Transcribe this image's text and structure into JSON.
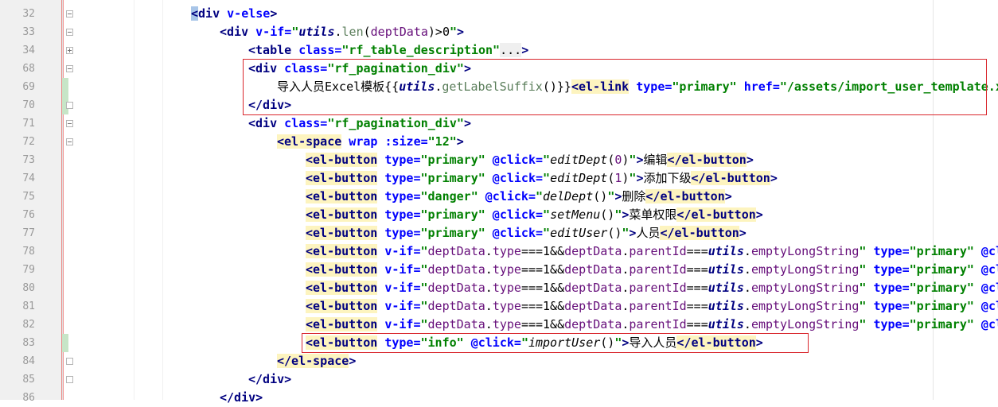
{
  "editor": {
    "lines": [
      {
        "num": "32",
        "indent": 0,
        "fold": "minus",
        "tokens": [
          {
            "t": "<",
            "c": "k-tag k-cur"
          },
          {
            "t": "div",
            "c": "k-tag"
          },
          {
            "t": " v-else",
            "c": "k-attr"
          },
          {
            "t": ">",
            "c": "k-tag"
          }
        ]
      },
      {
        "num": "33",
        "indent": 1,
        "fold": "minus",
        "tokens": [
          {
            "t": "<div",
            "c": "k-tag"
          },
          {
            "t": " v-if=",
            "c": "k-attr"
          },
          {
            "t": "\"",
            "c": "k-str"
          },
          {
            "t": "utils",
            "c": "k-kw"
          },
          {
            "t": ".",
            "c": "k-plain"
          },
          {
            "t": "len",
            "c": "k-fn"
          },
          {
            "t": "(",
            "c": "k-plain"
          },
          {
            "t": "deptData",
            "c": "k-var"
          },
          {
            "t": ")>0",
            "c": "k-plain"
          },
          {
            "t": "\"",
            "c": "k-str"
          },
          {
            "t": ">",
            "c": "k-tag"
          }
        ]
      },
      {
        "num": "34",
        "indent": 2,
        "fold": "plus",
        "tokens": [
          {
            "t": "<table",
            "c": "k-tag"
          },
          {
            "t": " class=",
            "c": "k-attr"
          },
          {
            "t": "\"rf_table_description\"",
            "c": "k-str"
          },
          {
            "t": "...",
            "c": "k-plain k-tagbg"
          },
          {
            "t": ">",
            "c": "k-tag"
          }
        ]
      },
      {
        "num": "68",
        "indent": 2,
        "fold": "minus",
        "tokens": [
          {
            "t": "<div",
            "c": "k-tag"
          },
          {
            "t": " class=",
            "c": "k-attr"
          },
          {
            "t": "\"rf_pagination_div\"",
            "c": "k-str"
          },
          {
            "t": ">",
            "c": "k-tag"
          }
        ]
      },
      {
        "num": "69",
        "indent": 3,
        "fold": "",
        "tokens": [
          {
            "t": "导入人员Excel模板{{",
            "c": "k-plain"
          },
          {
            "t": "utils",
            "c": "k-kw"
          },
          {
            "t": ".",
            "c": "k-plain"
          },
          {
            "t": "getLabelSuffix",
            "c": "k-fn"
          },
          {
            "t": "()}}",
            "c": "k-plain"
          },
          {
            "t": "<el-link",
            "c": "k-tag k-hl"
          },
          {
            "t": " type=",
            "c": "k-attr"
          },
          {
            "t": "\"primary\"",
            "c": "k-str"
          },
          {
            "t": " href=",
            "c": "k-attr"
          },
          {
            "t": "\"/assets/import_user_template.x",
            "c": "k-str"
          }
        ]
      },
      {
        "num": "70",
        "indent": 2,
        "fold": "end",
        "tokens": [
          {
            "t": "</div>",
            "c": "k-tag"
          }
        ]
      },
      {
        "num": "71",
        "indent": 2,
        "fold": "minus",
        "tokens": [
          {
            "t": "<div",
            "c": "k-tag"
          },
          {
            "t": " class=",
            "c": "k-attr"
          },
          {
            "t": "\"rf_pagination_div\"",
            "c": "k-str"
          },
          {
            "t": ">",
            "c": "k-tag"
          }
        ]
      },
      {
        "num": "72",
        "indent": 3,
        "fold": "minus",
        "tokens": [
          {
            "t": "<el-space",
            "c": "k-tag k-hl"
          },
          {
            "t": " wrap",
            "c": "k-attr"
          },
          {
            "t": " :size=",
            "c": "k-attr"
          },
          {
            "t": "\"12\"",
            "c": "k-str"
          },
          {
            "t": ">",
            "c": "k-tag"
          }
        ]
      },
      {
        "num": "73",
        "indent": 4,
        "fold": "",
        "tokens": [
          {
            "t": "<el-button",
            "c": "k-tag k-hl"
          },
          {
            "t": " type=",
            "c": "k-attr"
          },
          {
            "t": "\"primary\"",
            "c": "k-str"
          },
          {
            "t": " @click=",
            "c": "k-attr"
          },
          {
            "t": "\"",
            "c": "k-str"
          },
          {
            "t": "editDept",
            "c": "k-ital k-plain"
          },
          {
            "t": "(",
            "c": "k-plain"
          },
          {
            "t": "0",
            "c": "k-var"
          },
          {
            "t": ")",
            "c": "k-plain"
          },
          {
            "t": "\"",
            "c": "k-str"
          },
          {
            "t": ">",
            "c": "k-tag"
          },
          {
            "t": "编辑",
            "c": "k-plain"
          },
          {
            "t": "</el-button",
            "c": "k-tag k-hl"
          },
          {
            "t": ">",
            "c": "k-tag"
          }
        ]
      },
      {
        "num": "74",
        "indent": 4,
        "fold": "",
        "tokens": [
          {
            "t": "<el-button",
            "c": "k-tag k-hl"
          },
          {
            "t": " type=",
            "c": "k-attr"
          },
          {
            "t": "\"primary\"",
            "c": "k-str"
          },
          {
            "t": " @click=",
            "c": "k-attr"
          },
          {
            "t": "\"",
            "c": "k-str"
          },
          {
            "t": "editDept",
            "c": "k-ital k-plain"
          },
          {
            "t": "(",
            "c": "k-plain"
          },
          {
            "t": "1",
            "c": "k-var"
          },
          {
            "t": ")",
            "c": "k-plain"
          },
          {
            "t": "\"",
            "c": "k-str"
          },
          {
            "t": ">",
            "c": "k-tag"
          },
          {
            "t": "添加下级",
            "c": "k-plain"
          },
          {
            "t": "</el-button",
            "c": "k-tag k-hl"
          },
          {
            "t": ">",
            "c": "k-tag"
          }
        ]
      },
      {
        "num": "75",
        "indent": 4,
        "fold": "",
        "tokens": [
          {
            "t": "<el-button",
            "c": "k-tag k-hl"
          },
          {
            "t": " type=",
            "c": "k-attr"
          },
          {
            "t": "\"danger\"",
            "c": "k-str"
          },
          {
            "t": " @click=",
            "c": "k-attr"
          },
          {
            "t": "\"",
            "c": "k-str"
          },
          {
            "t": "delDept",
            "c": "k-ital k-plain"
          },
          {
            "t": "()",
            "c": "k-plain"
          },
          {
            "t": "\"",
            "c": "k-str"
          },
          {
            "t": ">",
            "c": "k-tag"
          },
          {
            "t": "删除",
            "c": "k-plain"
          },
          {
            "t": "</el-button",
            "c": "k-tag k-hl"
          },
          {
            "t": ">",
            "c": "k-tag"
          }
        ]
      },
      {
        "num": "76",
        "indent": 4,
        "fold": "",
        "tokens": [
          {
            "t": "<el-button",
            "c": "k-tag k-hl"
          },
          {
            "t": " type=",
            "c": "k-attr"
          },
          {
            "t": "\"primary\"",
            "c": "k-str"
          },
          {
            "t": " @click=",
            "c": "k-attr"
          },
          {
            "t": "\"",
            "c": "k-str"
          },
          {
            "t": "setMenu",
            "c": "k-ital k-plain"
          },
          {
            "t": "()",
            "c": "k-plain"
          },
          {
            "t": "\"",
            "c": "k-str"
          },
          {
            "t": ">",
            "c": "k-tag"
          },
          {
            "t": "菜单权限",
            "c": "k-plain"
          },
          {
            "t": "</el-button",
            "c": "k-tag k-hl"
          },
          {
            "t": ">",
            "c": "k-tag"
          }
        ]
      },
      {
        "num": "77",
        "indent": 4,
        "fold": "",
        "tokens": [
          {
            "t": "<el-button",
            "c": "k-tag k-hl"
          },
          {
            "t": " type=",
            "c": "k-attr"
          },
          {
            "t": "\"primary\"",
            "c": "k-str"
          },
          {
            "t": " @click=",
            "c": "k-attr"
          },
          {
            "t": "\"",
            "c": "k-str"
          },
          {
            "t": "editUser",
            "c": "k-ital k-plain"
          },
          {
            "t": "()",
            "c": "k-plain"
          },
          {
            "t": "\"",
            "c": "k-str"
          },
          {
            "t": ">",
            "c": "k-tag"
          },
          {
            "t": "人员",
            "c": "k-plain"
          },
          {
            "t": "</el-button",
            "c": "k-tag k-hl"
          },
          {
            "t": ">",
            "c": "k-tag"
          }
        ]
      },
      {
        "num": "78",
        "indent": 4,
        "fold": "",
        "tokens": [
          {
            "t": "<el-button",
            "c": "k-tag k-hl"
          },
          {
            "t": " v-if=",
            "c": "k-attr"
          },
          {
            "t": "\"",
            "c": "k-str"
          },
          {
            "t": "deptData",
            "c": "k-var"
          },
          {
            "t": ".",
            "c": "k-plain"
          },
          {
            "t": "type",
            "c": "k-var"
          },
          {
            "t": "===1&&",
            "c": "k-plain"
          },
          {
            "t": "deptData",
            "c": "k-var"
          },
          {
            "t": ".",
            "c": "k-plain"
          },
          {
            "t": "parentId",
            "c": "k-var"
          },
          {
            "t": "===",
            "c": "k-plain"
          },
          {
            "t": "utils",
            "c": "k-kw"
          },
          {
            "t": ".",
            "c": "k-plain"
          },
          {
            "t": "emptyLongString",
            "c": "k-var"
          },
          {
            "t": "\"",
            "c": "k-str"
          },
          {
            "t": " type=",
            "c": "k-attr"
          },
          {
            "t": "\"primary\"",
            "c": "k-str"
          },
          {
            "t": " @cl",
            "c": "k-attr"
          }
        ]
      },
      {
        "num": "79",
        "indent": 4,
        "fold": "",
        "tokens": [
          {
            "t": "<el-button",
            "c": "k-tag k-hl"
          },
          {
            "t": " v-if=",
            "c": "k-attr"
          },
          {
            "t": "\"",
            "c": "k-str"
          },
          {
            "t": "deptData",
            "c": "k-var"
          },
          {
            "t": ".",
            "c": "k-plain"
          },
          {
            "t": "type",
            "c": "k-var"
          },
          {
            "t": "===1&&",
            "c": "k-plain"
          },
          {
            "t": "deptData",
            "c": "k-var"
          },
          {
            "t": ".",
            "c": "k-plain"
          },
          {
            "t": "parentId",
            "c": "k-var"
          },
          {
            "t": "===",
            "c": "k-plain"
          },
          {
            "t": "utils",
            "c": "k-kw"
          },
          {
            "t": ".",
            "c": "k-plain"
          },
          {
            "t": "emptyLongString",
            "c": "k-var"
          },
          {
            "t": "\"",
            "c": "k-str"
          },
          {
            "t": " type=",
            "c": "k-attr"
          },
          {
            "t": "\"primary\"",
            "c": "k-str"
          },
          {
            "t": " @cl",
            "c": "k-attr"
          }
        ]
      },
      {
        "num": "80",
        "indent": 4,
        "fold": "",
        "tokens": [
          {
            "t": "<el-button",
            "c": "k-tag k-hl"
          },
          {
            "t": " v-if=",
            "c": "k-attr"
          },
          {
            "t": "\"",
            "c": "k-str"
          },
          {
            "t": "deptData",
            "c": "k-var"
          },
          {
            "t": ".",
            "c": "k-plain"
          },
          {
            "t": "type",
            "c": "k-var"
          },
          {
            "t": "===1&&",
            "c": "k-plain"
          },
          {
            "t": "deptData",
            "c": "k-var"
          },
          {
            "t": ".",
            "c": "k-plain"
          },
          {
            "t": "parentId",
            "c": "k-var"
          },
          {
            "t": "===",
            "c": "k-plain"
          },
          {
            "t": "utils",
            "c": "k-kw"
          },
          {
            "t": ".",
            "c": "k-plain"
          },
          {
            "t": "emptyLongString",
            "c": "k-var"
          },
          {
            "t": "\"",
            "c": "k-str"
          },
          {
            "t": " type=",
            "c": "k-attr"
          },
          {
            "t": "\"primary\"",
            "c": "k-str"
          },
          {
            "t": " @cl",
            "c": "k-attr"
          }
        ]
      },
      {
        "num": "81",
        "indent": 4,
        "fold": "",
        "tokens": [
          {
            "t": "<el-button",
            "c": "k-tag k-hl"
          },
          {
            "t": " v-if=",
            "c": "k-attr"
          },
          {
            "t": "\"",
            "c": "k-str"
          },
          {
            "t": "deptData",
            "c": "k-var"
          },
          {
            "t": ".",
            "c": "k-plain"
          },
          {
            "t": "type",
            "c": "k-var"
          },
          {
            "t": "===1&&",
            "c": "k-plain"
          },
          {
            "t": "deptData",
            "c": "k-var"
          },
          {
            "t": ".",
            "c": "k-plain"
          },
          {
            "t": "parentId",
            "c": "k-var"
          },
          {
            "t": "===",
            "c": "k-plain"
          },
          {
            "t": "utils",
            "c": "k-kw"
          },
          {
            "t": ".",
            "c": "k-plain"
          },
          {
            "t": "emptyLongString",
            "c": "k-var"
          },
          {
            "t": "\"",
            "c": "k-str"
          },
          {
            "t": " type=",
            "c": "k-attr"
          },
          {
            "t": "\"primary\"",
            "c": "k-str"
          },
          {
            "t": " @cl",
            "c": "k-attr"
          }
        ]
      },
      {
        "num": "82",
        "indent": 4,
        "fold": "",
        "tokens": [
          {
            "t": "<el-button",
            "c": "k-tag k-hl"
          },
          {
            "t": " v-if=",
            "c": "k-attr"
          },
          {
            "t": "\"",
            "c": "k-str"
          },
          {
            "t": "deptData",
            "c": "k-var"
          },
          {
            "t": ".",
            "c": "k-plain"
          },
          {
            "t": "type",
            "c": "k-var"
          },
          {
            "t": "===1&&",
            "c": "k-plain"
          },
          {
            "t": "deptData",
            "c": "k-var"
          },
          {
            "t": ".",
            "c": "k-plain"
          },
          {
            "t": "parentId",
            "c": "k-var"
          },
          {
            "t": "===",
            "c": "k-plain"
          },
          {
            "t": "utils",
            "c": "k-kw"
          },
          {
            "t": ".",
            "c": "k-plain"
          },
          {
            "t": "emptyLongString",
            "c": "k-var"
          },
          {
            "t": "\"",
            "c": "k-str"
          },
          {
            "t": " type=",
            "c": "k-attr"
          },
          {
            "t": "\"primary\"",
            "c": "k-str"
          },
          {
            "t": " @cl",
            "c": "k-attr"
          }
        ]
      },
      {
        "num": "83",
        "indent": 4,
        "fold": "",
        "tokens": [
          {
            "t": "<el-button",
            "c": "k-tag k-hl"
          },
          {
            "t": " type=",
            "c": "k-attr"
          },
          {
            "t": "\"info\"",
            "c": "k-str"
          },
          {
            "t": " @click=",
            "c": "k-attr"
          },
          {
            "t": "\"",
            "c": "k-str"
          },
          {
            "t": "importUser",
            "c": "k-ital k-plain"
          },
          {
            "t": "()",
            "c": "k-plain"
          },
          {
            "t": "\"",
            "c": "k-str"
          },
          {
            "t": ">",
            "c": "k-tag"
          },
          {
            "t": "导入人员",
            "c": "k-plain"
          },
          {
            "t": "</el-button",
            "c": "k-tag k-hl"
          },
          {
            "t": ">",
            "c": "k-tag"
          }
        ]
      },
      {
        "num": "84",
        "indent": 3,
        "fold": "end",
        "tokens": [
          {
            "t": "</el-space",
            "c": "k-tag k-hl"
          },
          {
            "t": ">",
            "c": "k-tag"
          }
        ]
      },
      {
        "num": "85",
        "indent": 2,
        "fold": "end",
        "tokens": [
          {
            "t": "</div>",
            "c": "k-tag"
          }
        ]
      },
      {
        "num": "86",
        "indent": 1,
        "fold": "",
        "tokens": [
          {
            "t": "</div>",
            "c": "k-tag"
          }
        ]
      }
    ],
    "modified_lines": [
      "69",
      "70",
      "83"
    ],
    "highlight_boxes": [
      {
        "name": "highlight-box-template-link",
        "lines": [
          "68",
          "70"
        ]
      },
      {
        "name": "highlight-box-import-button",
        "lines": [
          "83",
          "83"
        ]
      }
    ]
  }
}
